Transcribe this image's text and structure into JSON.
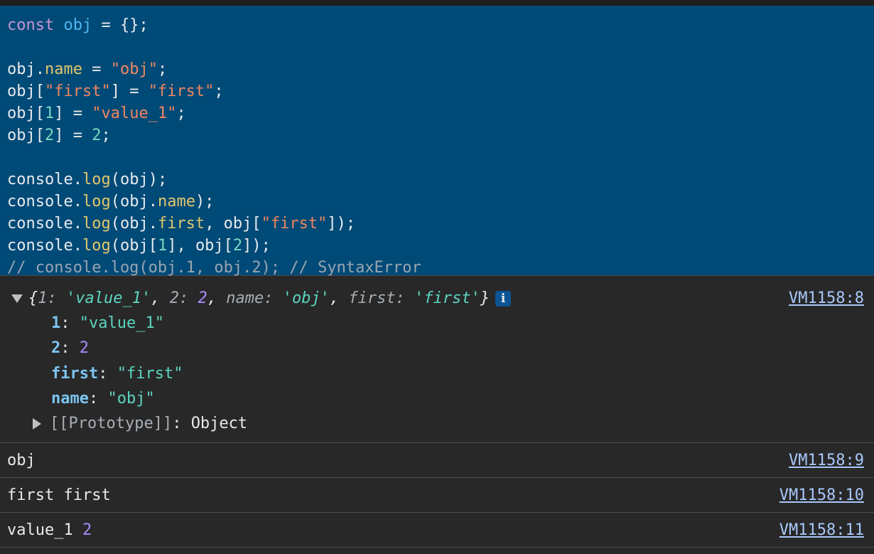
{
  "code": {
    "line1": {
      "kw": "const",
      "var": "obj",
      "rest": " = {};"
    },
    "line3": {
      "a": "obj.",
      "prop": "name",
      "b": " = ",
      "str": "\"obj\"",
      "c": ";"
    },
    "line4": {
      "a": "obj[",
      "str1": "\"first\"",
      "b": "] = ",
      "str2": "\"first\"",
      "c": ";"
    },
    "line5": {
      "a": "obj[",
      "num": "1",
      "b": "] = ",
      "str": "\"value_1\"",
      "c": ";"
    },
    "line6": {
      "a": "obj[",
      "num1": "2",
      "b": "] = ",
      "num2": "2",
      "c": ";"
    },
    "line8": {
      "a": "console.",
      "fn": "log",
      "b": "(obj);"
    },
    "line9": {
      "a": "console.",
      "fn": "log",
      "b": "(obj.",
      "prop": "name",
      "c": ");"
    },
    "line10": {
      "a": "console.",
      "fn": "log",
      "b": "(obj.",
      "prop": "first",
      "c": ", obj[",
      "str": "\"first\"",
      "d": "]);"
    },
    "line11": {
      "a": "console.",
      "fn": "log",
      "b": "(obj[",
      "num1": "1",
      "c": "], obj[",
      "num2": "2",
      "d": "]);"
    },
    "line12": {
      "comment": "// console.log(obj.1, obj.2); // SyntaxError"
    }
  },
  "output": {
    "object_entry": {
      "summary": {
        "open": "{",
        "k1": "1",
        "v1": "'value_1'",
        "k2": "2",
        "v2": "2",
        "k3": "name",
        "v3": "'obj'",
        "k4": "first",
        "v4": "'first'",
        "close": "}",
        "info": "i"
      },
      "props": [
        {
          "key": "1",
          "value": "\"value_1\"",
          "type": "string"
        },
        {
          "key": "2",
          "value": "2",
          "type": "number"
        },
        {
          "key": "first",
          "value": "\"first\"",
          "type": "string"
        },
        {
          "key": "name",
          "value": "\"obj\"",
          "type": "string"
        }
      ],
      "prototype": {
        "key": "[[Prototype]]",
        "value": "Object"
      },
      "link": "VM1158:8"
    },
    "entry2": {
      "text": "obj",
      "link": "VM1158:9"
    },
    "entry3": {
      "text": "first first",
      "link": "VM1158:10"
    },
    "entry4": {
      "text": "value_1",
      "num": "2",
      "link": "VM1158:11"
    }
  }
}
